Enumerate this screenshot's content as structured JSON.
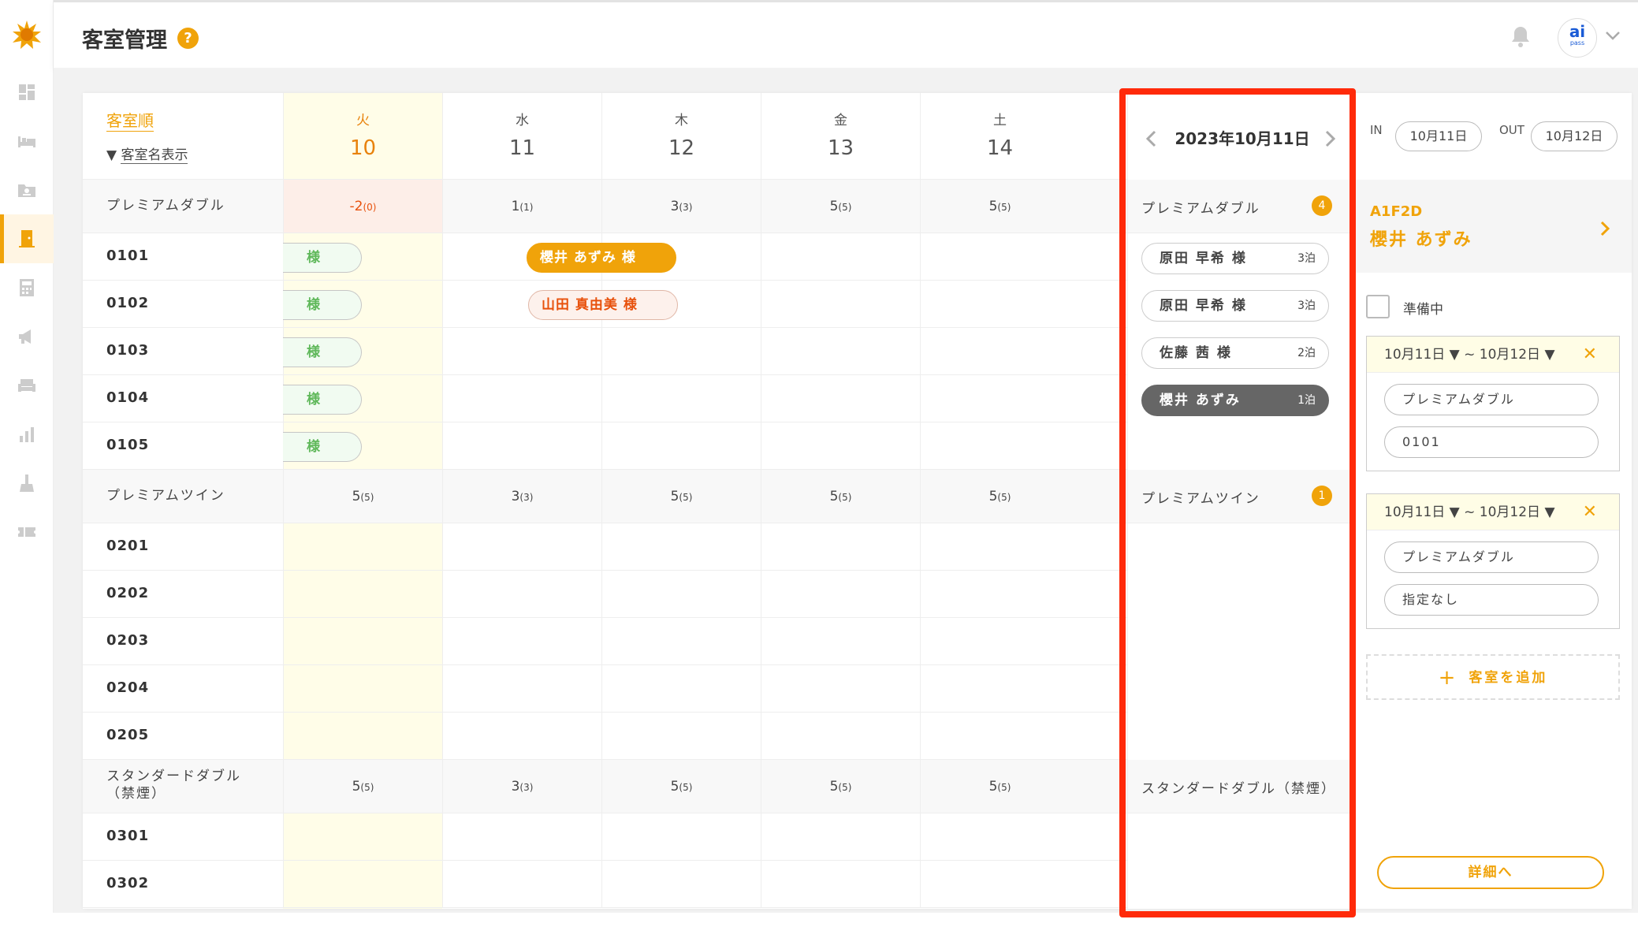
{
  "header": {
    "title": "客室管理",
    "help": "?",
    "avatar_main": "ai",
    "avatar_sub": "pass"
  },
  "sidebar": {
    "items": [
      "dashboard-icon",
      "bed-icon",
      "folder-user-icon",
      "door-icon",
      "calculator-icon",
      "megaphone-icon",
      "sofa-icon",
      "bar-chart-icon",
      "cleaning-icon",
      "ticket-icon"
    ],
    "active": "door-icon"
  },
  "grid": {
    "sort_label": "客室順",
    "name_toggle": "客室名表示",
    "days": [
      {
        "weekday": "火",
        "day": "10",
        "today": true
      },
      {
        "weekday": "水",
        "day": "11"
      },
      {
        "weekday": "木",
        "day": "12"
      },
      {
        "weekday": "金",
        "day": "13"
      },
      {
        "weekday": "土",
        "day": "14"
      }
    ],
    "categories": [
      {
        "name": "プレミアムダブル",
        "counts": [
          [
            "-2",
            "(0)"
          ],
          [
            "1",
            "(1)"
          ],
          [
            "3",
            "(3)"
          ],
          [
            "5",
            "(5)"
          ],
          [
            "5",
            "(5)"
          ]
        ],
        "rooms": [
          "0101",
          "0102",
          "0103",
          "0104",
          "0105"
        ]
      },
      {
        "name": "プレミアムツイン",
        "counts": [
          [
            "5",
            "(5)"
          ],
          [
            "3",
            "(3)"
          ],
          [
            "5",
            "(5)"
          ],
          [
            "5",
            "(5)"
          ],
          [
            "5",
            "(5)"
          ]
        ],
        "rooms": [
          "0201",
          "0202",
          "0203",
          "0204",
          "0205"
        ]
      },
      {
        "name": "スタンダードダブル\n（禁煙）",
        "counts": [
          [
            "5",
            "(5)"
          ],
          [
            "3",
            "(3)"
          ],
          [
            "5",
            "(5)"
          ],
          [
            "5",
            "(5)"
          ],
          [
            "5",
            "(5)"
          ]
        ],
        "rooms": [
          "0301",
          "0302"
        ]
      }
    ],
    "bookings": [
      {
        "text": "様",
        "style": "g"
      },
      {
        "text": "様",
        "style": "g"
      },
      {
        "text": "様",
        "style": "g"
      },
      {
        "text": "様",
        "style": "g"
      },
      {
        "text": "様",
        "style": "g"
      },
      {
        "text": "櫻井 あずみ 様",
        "style": "o"
      },
      {
        "text": "山田 真由美 様",
        "style": "p"
      }
    ]
  },
  "middle": {
    "date": "2023年10月11日",
    "categories": [
      {
        "name": "プレミアムダブル",
        "count": "4"
      },
      {
        "name": "プレミアムツイン",
        "count": "1"
      },
      {
        "name": "スタンダードダブル（禁煙）",
        "count": ""
      }
    ],
    "guests": [
      {
        "name": "原田 早希 様",
        "nights": "3泊"
      },
      {
        "name": "原田 早希 様",
        "nights": "3泊"
      },
      {
        "name": "佐藤 茜 様",
        "nights": "2泊"
      },
      {
        "name": "櫻井 あずみ",
        "nights": "1泊",
        "selected": true
      }
    ]
  },
  "right": {
    "in_label": "IN",
    "in_date": "10月11日",
    "out_label": "OUT",
    "out_date": "10月12日",
    "res_code": "A1F2D",
    "res_name": "櫻井 あずみ",
    "preparing": "準備中",
    "cards": [
      {
        "range": "10月11日 ▼ ~ 10月12日 ▼",
        "type": "プレミアムダブル",
        "room": "0101"
      },
      {
        "range": "10月11日 ▼ ~ 10月12日 ▼",
        "type": "プレミアムダブル",
        "room": "指定なし"
      }
    ],
    "add_room": "客室を追加",
    "detail": "詳細へ"
  },
  "colors": {
    "accent": "#f0a30a",
    "today_bg": "#fffde8",
    "alert": "#e8510c",
    "highlight_box": "#ff2a0a"
  }
}
